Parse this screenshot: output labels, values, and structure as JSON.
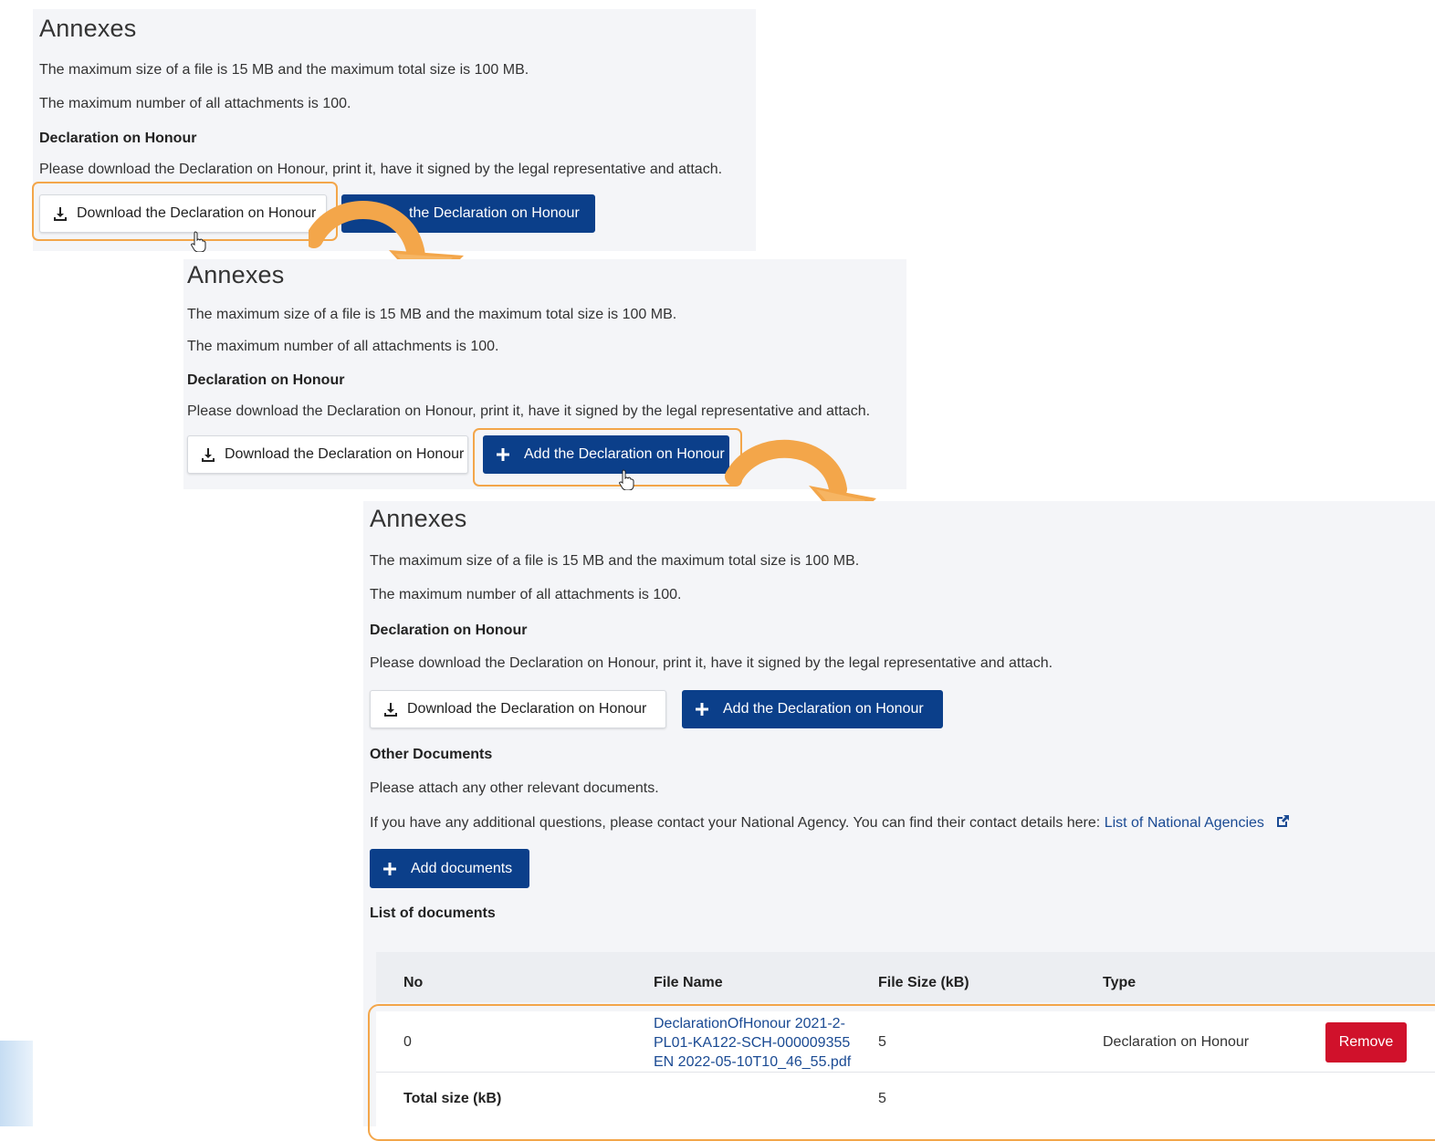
{
  "annexes_title": "Annexes",
  "max_size_text": "The maximum size of a file is 15 MB and the maximum total size is 100 MB.",
  "max_number_text": "The maximum number of all attachments is 100.",
  "doh_heading": "Declaration on Honour",
  "doh_instructions": "Please download the Declaration on Honour, print it, have it signed by the legal representative and attach.",
  "download_btn_label": "Download the Declaration on Honour",
  "add_btn_label": "Add the Declaration on Honour",
  "add_btn_partial_label": "the Declaration on Honour",
  "other_docs_heading": "Other Documents",
  "other_docs_text": "Please attach any other relevant documents.",
  "contact_text": "If you have any additional questions, please contact your National Agency. You can find their contact details here:",
  "contact_link": "List of National Agencies",
  "add_documents_label": "Add documents",
  "list_heading": "List of documents",
  "table": {
    "headers": {
      "no": "No",
      "file_name": "File Name",
      "file_size": "File Size (kB)",
      "type": "Type"
    },
    "row": {
      "no": "0",
      "file_name_line1": "DeclarationOfHonour 2021-2-",
      "file_name_line2": "PL01-KA122-SCH-000009355",
      "file_name_line3": "EN 2022-05-10T10_46_55.pdf",
      "file_size": "5",
      "type": "Declaration on Honour",
      "remove_label": "Remove"
    },
    "total_label": "Total size (kB)",
    "total_value": "5"
  },
  "colors": {
    "primary": "#0b3f8a",
    "highlight": "#f3a64a",
    "danger": "#d0112b",
    "link": "#1a4a93"
  },
  "icons": [
    "download-icon",
    "plus-icon",
    "external-link-icon",
    "hand-cursor-icon",
    "curved-arrow-icon"
  ]
}
